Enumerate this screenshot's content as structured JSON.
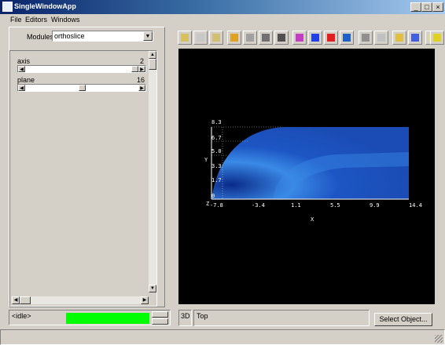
{
  "window": {
    "title": "SingleWindowApp",
    "minimize": "_",
    "maximize": "□",
    "close": "×"
  },
  "menu": [
    "File",
    "Editors",
    "Windows"
  ],
  "modules": {
    "label": "Modules",
    "value": "orthoslice"
  },
  "sliders": [
    {
      "label": "axis",
      "value": "2",
      "fraction": 1.0
    },
    {
      "label": "plane",
      "value": "16",
      "fraction": 0.53
    }
  ],
  "toolbar": {
    "icons": [
      "view-home-icon",
      "view-all-icon",
      "seek-icon",
      "rotate-icon",
      "zoom-icon",
      "select-icon",
      "interact-icon",
      "view-x-icon",
      "view-y-icon",
      "view-z-icon",
      "view-color-icon",
      "snapshot-icon",
      "print-icon",
      "stereo-icon",
      "perspective-icon",
      "light-icon",
      "render-icon"
    ]
  },
  "plot": {
    "xlabel": "X",
    "ylabel": "Y",
    "zlabel": "Z",
    "xticks": [
      "-7.8",
      "-3.4",
      "1.1",
      "5.5",
      "9.9",
      "14.4"
    ],
    "yticks": [
      "8.3",
      "6.7",
      "5.0",
      "3.3",
      "1.7",
      "0"
    ],
    "colors": {
      "background": "#000000",
      "field": "#1a4fbf",
      "wake": "#2d7fe0"
    }
  },
  "status": {
    "state": "<idle>",
    "progress_color": "#00ff00",
    "mode_3d": "3D",
    "view_name": "Top",
    "select_button": "Select Object..."
  }
}
